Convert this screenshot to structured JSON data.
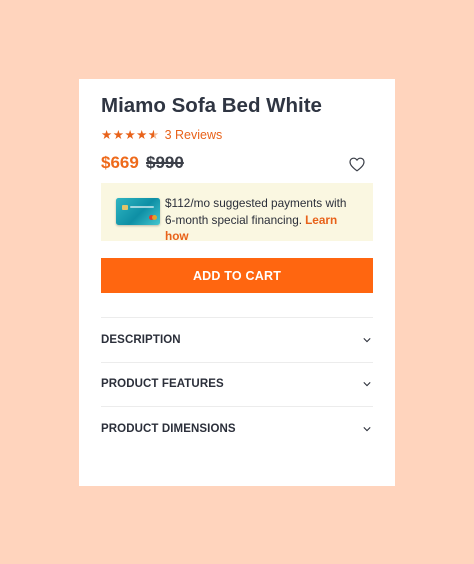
{
  "product": {
    "title": "Miamo Sofa Bed White",
    "rating": 4.5,
    "reviews_label": "3 Reviews",
    "price": "$669",
    "old_price": "$990"
  },
  "icons": {
    "wishlist": "heart-outline-icon",
    "financing_card": "credit-card-icon",
    "accordion_toggle": "chevron-down-icon"
  },
  "financing": {
    "text": "$112/mo suggested payments with 6-month special financing.",
    "link_label": "Learn how"
  },
  "cart": {
    "add_label": "ADD TO CART"
  },
  "accordion": {
    "items": [
      {
        "label": "DESCRIPTION"
      },
      {
        "label": "PRODUCT FEATURES"
      },
      {
        "label": "PRODUCT DIMENSIONS"
      }
    ]
  },
  "colors": {
    "page_background": "#ffd4bd",
    "accent": "#ff6610",
    "financing_background": "#faf7e1"
  }
}
